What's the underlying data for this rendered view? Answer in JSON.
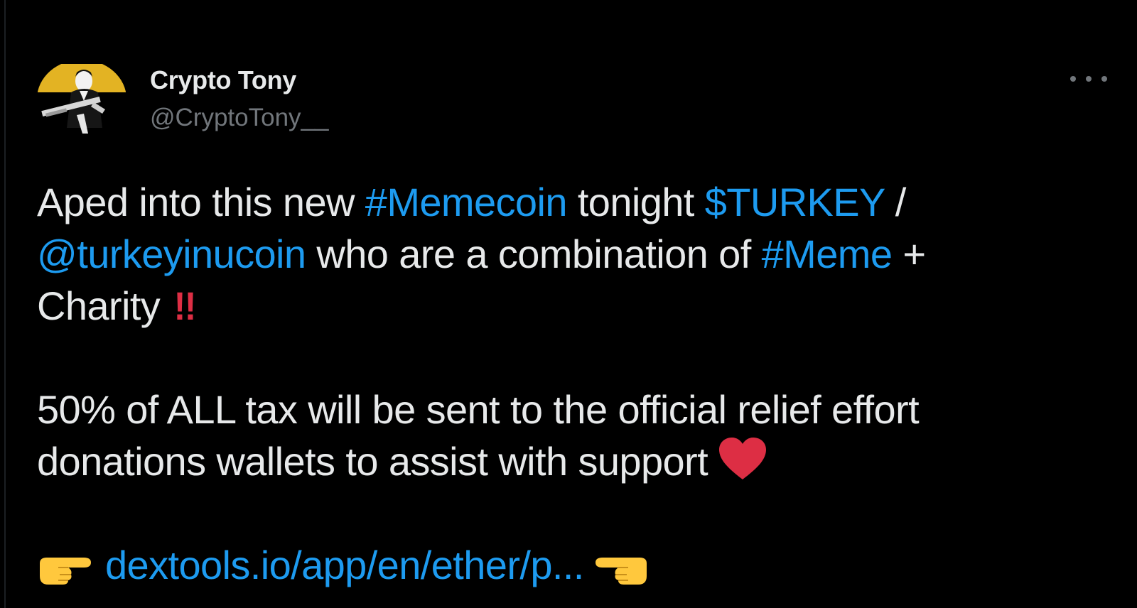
{
  "author": {
    "name": "Crypto Tony",
    "handle": "@CryptoTony__"
  },
  "tweet": {
    "line1_a": "Aped into this new ",
    "hashtag_memecoin": "#Memecoin",
    "line1_b": " tonight ",
    "cashtag_turkey": "$TURKEY",
    "line1_c": " /",
    "mention_turkeyinucoin": "@turkeyinucoin",
    "line2_a": " who are a combination of ",
    "hashtag_meme": "#Meme",
    "line2_b": " +",
    "line3_a": "Charity",
    "double_exclamation": "!!",
    "line4": "50% of ALL tax will be sent to the official relief effort",
    "line5": "donations wallets to assist with support",
    "link_url": "dextools.io/app/en/ether/p..."
  },
  "icons": {
    "more": "more-options-icon",
    "heart": "red-heart-icon",
    "pointing_right": "pointing-right-hand-icon",
    "pointing_left": "pointing-left-hand-icon"
  },
  "colors": {
    "background": "#000000",
    "text": "#e7e9ea",
    "secondary": "#71767b",
    "link": "#1d9bf0",
    "heart": "#dd2e44",
    "emoji_hand": "#ffc83d"
  }
}
